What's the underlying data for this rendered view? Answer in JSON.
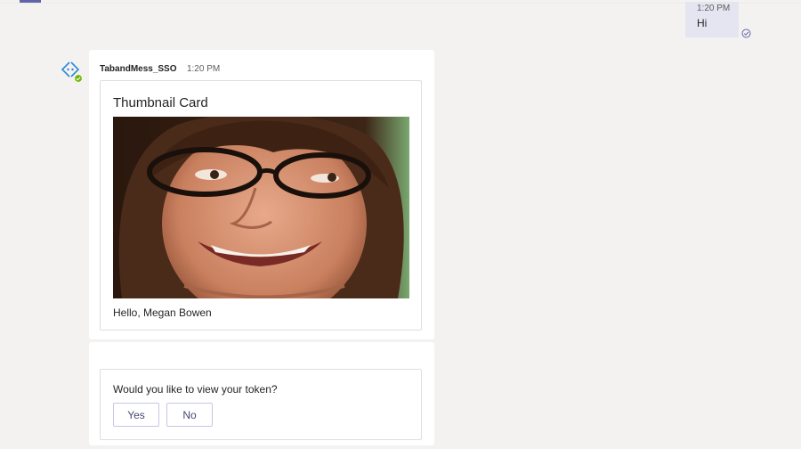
{
  "sent_message": {
    "time": "1:20 PM",
    "text": "Hi",
    "status_icon": "read-receipt-icon"
  },
  "bot_message": {
    "sender": "TabandMess_SSO",
    "time": "1:20 PM",
    "avatar_icon": "bot-app-icon",
    "card": {
      "title": "Thumbnail Card",
      "image": "portrait-photo",
      "text": "Hello, Megan Bowen"
    }
  },
  "token_prompt": {
    "question": "Would you like to view your token?",
    "buttons": {
      "yes": "Yes",
      "no": "No"
    }
  },
  "colors": {
    "background": "#f3f2f1",
    "sent_bubble": "#e5e5f1",
    "accent": "#6264a7",
    "button_text": "#464775",
    "status_green": "#6bb700"
  }
}
